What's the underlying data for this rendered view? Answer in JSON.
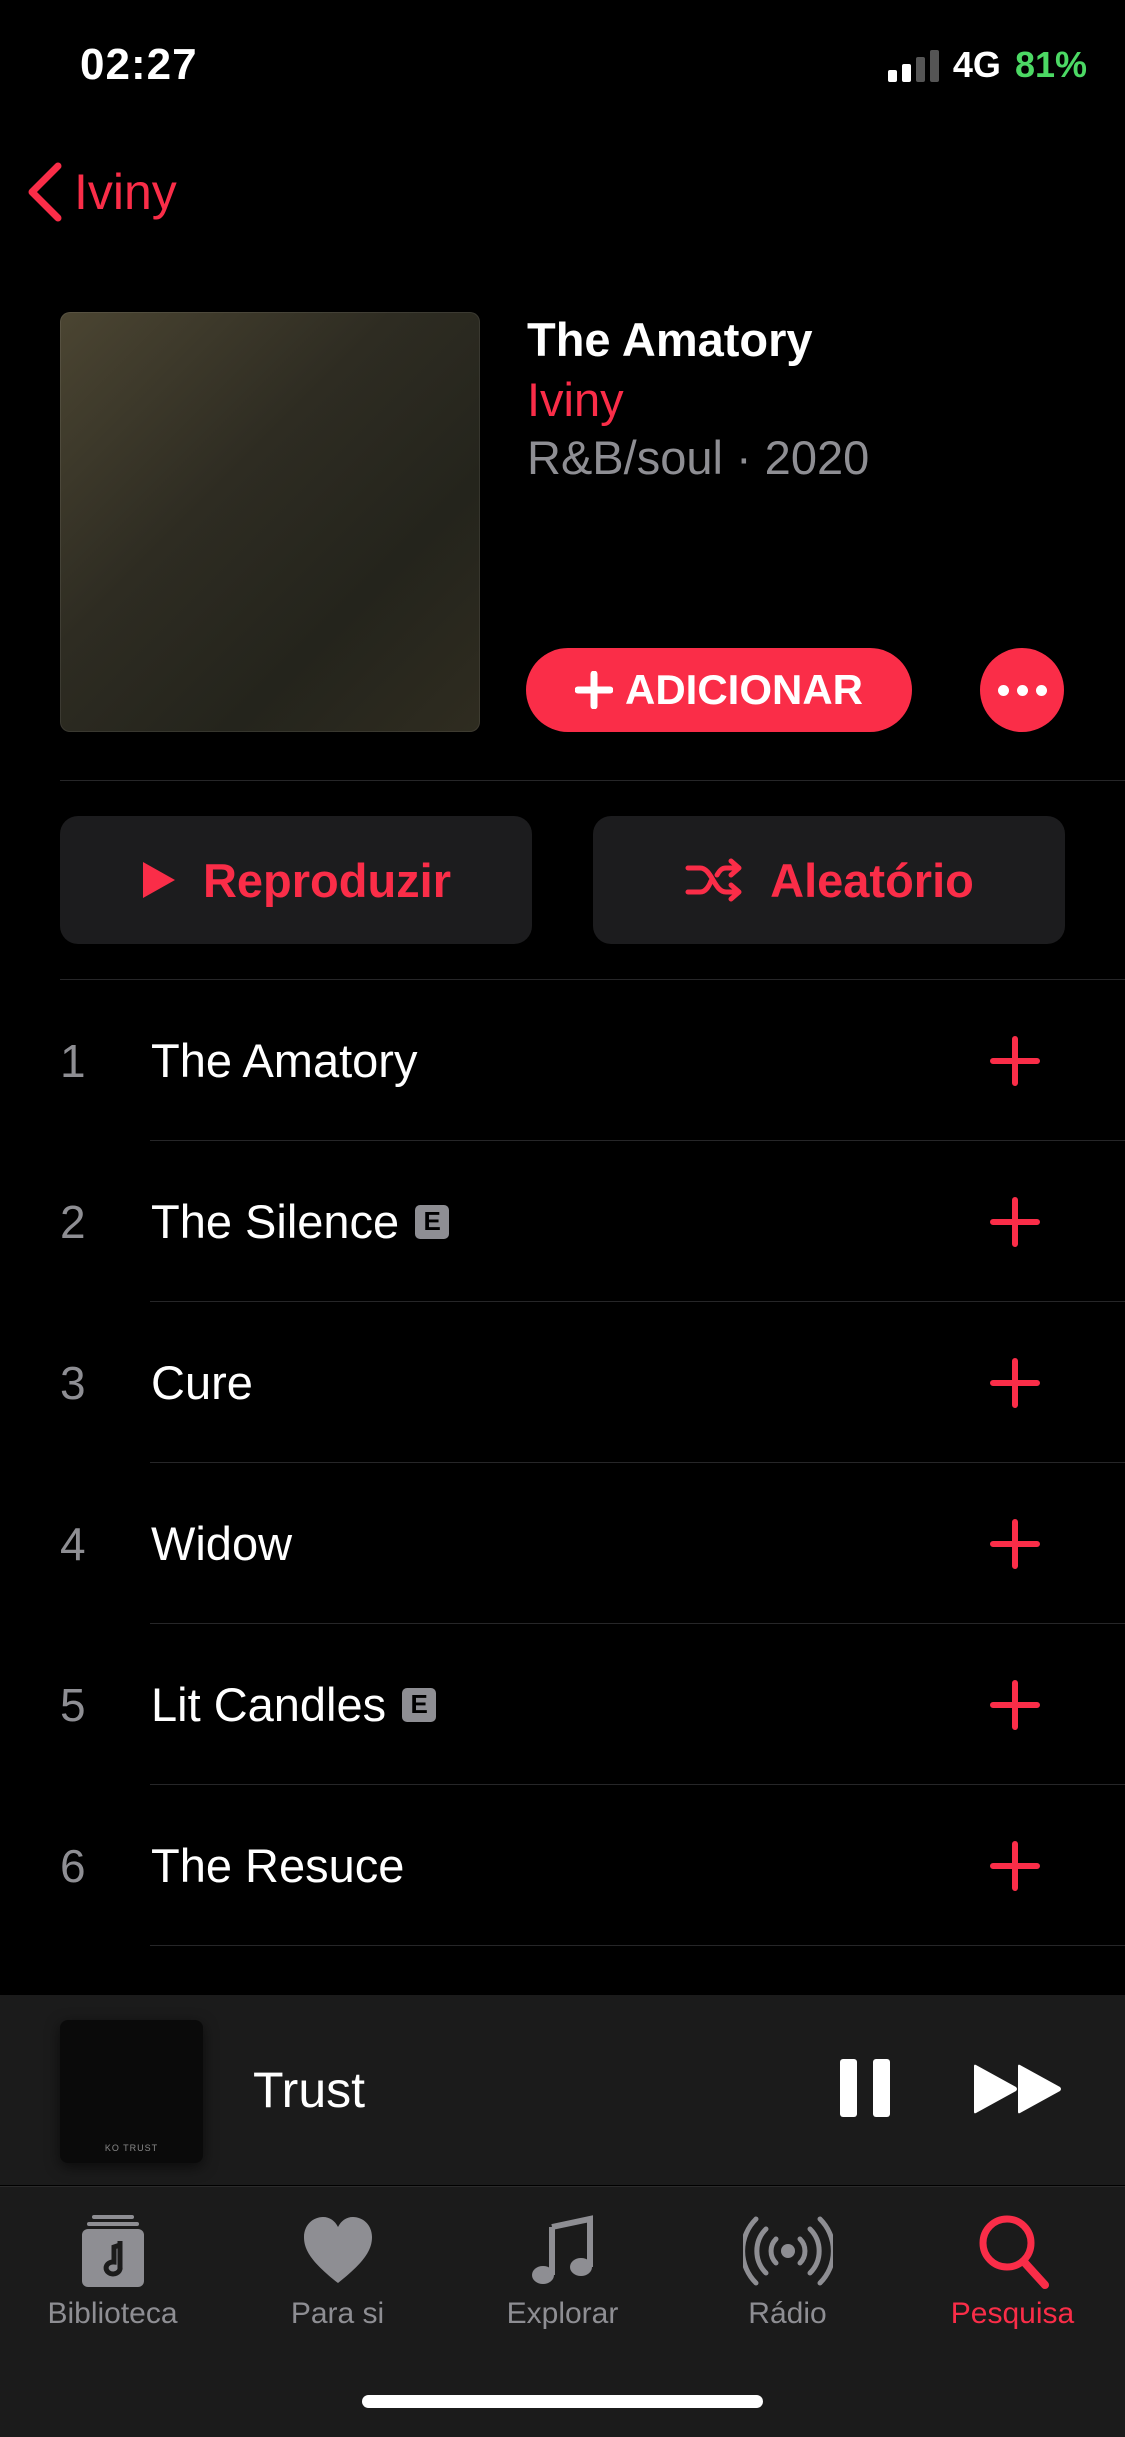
{
  "status_bar": {
    "time": "02:27",
    "network": "4G",
    "battery": "81%"
  },
  "nav": {
    "back_label": "Iviny"
  },
  "album": {
    "title": "The Amatory",
    "artist": "Iviny",
    "meta": "R&B/soul · 2020",
    "add_label": "ADICIONAR"
  },
  "actions": {
    "play_label": "Reproduzir",
    "shuffle_label": "Aleatório"
  },
  "tracks": [
    {
      "num": "1",
      "title": "The Amatory",
      "explicit": false
    },
    {
      "num": "2",
      "title": "The Silence",
      "explicit": true
    },
    {
      "num": "3",
      "title": "Cure",
      "explicit": false
    },
    {
      "num": "4",
      "title": "Widow",
      "explicit": false
    },
    {
      "num": "5",
      "title": "Lit Candles",
      "explicit": true
    },
    {
      "num": "6",
      "title": "The Resuce",
      "explicit": false
    }
  ],
  "explicit_badge": "E",
  "mini_player": {
    "title": "Trust",
    "art_label": "KO TRUST"
  },
  "tabs": [
    {
      "label": "Biblioteca",
      "icon": "library-icon"
    },
    {
      "label": "Para si",
      "icon": "heart-icon"
    },
    {
      "label": "Explorar",
      "icon": "music-note-icon"
    },
    {
      "label": "Rádio",
      "icon": "radio-icon"
    },
    {
      "label": "Pesquisa",
      "icon": "search-icon",
      "active": true
    }
  ],
  "colors": {
    "accent": "#fa2d48",
    "battery": "#4cd964",
    "secondary_text": "#8e8e93"
  }
}
